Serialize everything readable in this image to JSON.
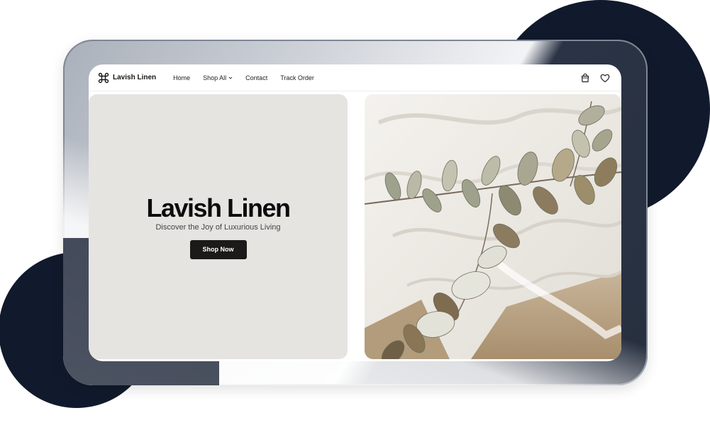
{
  "brand": {
    "name": "Lavish Linen",
    "icon": "command-icon"
  },
  "nav": {
    "items": [
      {
        "label": "Home"
      },
      {
        "label": "Shop All",
        "has_dropdown": true
      },
      {
        "label": "Contact"
      },
      {
        "label": "Track Order"
      }
    ],
    "icons": [
      "shopping-bag-icon",
      "heart-icon"
    ]
  },
  "hero": {
    "title": "Lavish Linen",
    "subtitle": "Discover the Joy of Luxurious Living",
    "cta_label": "Shop Now"
  },
  "colors": {
    "dark_navy": "#111a2c",
    "hero_panel": "#e6e4e1",
    "button": "#1c1a19"
  }
}
